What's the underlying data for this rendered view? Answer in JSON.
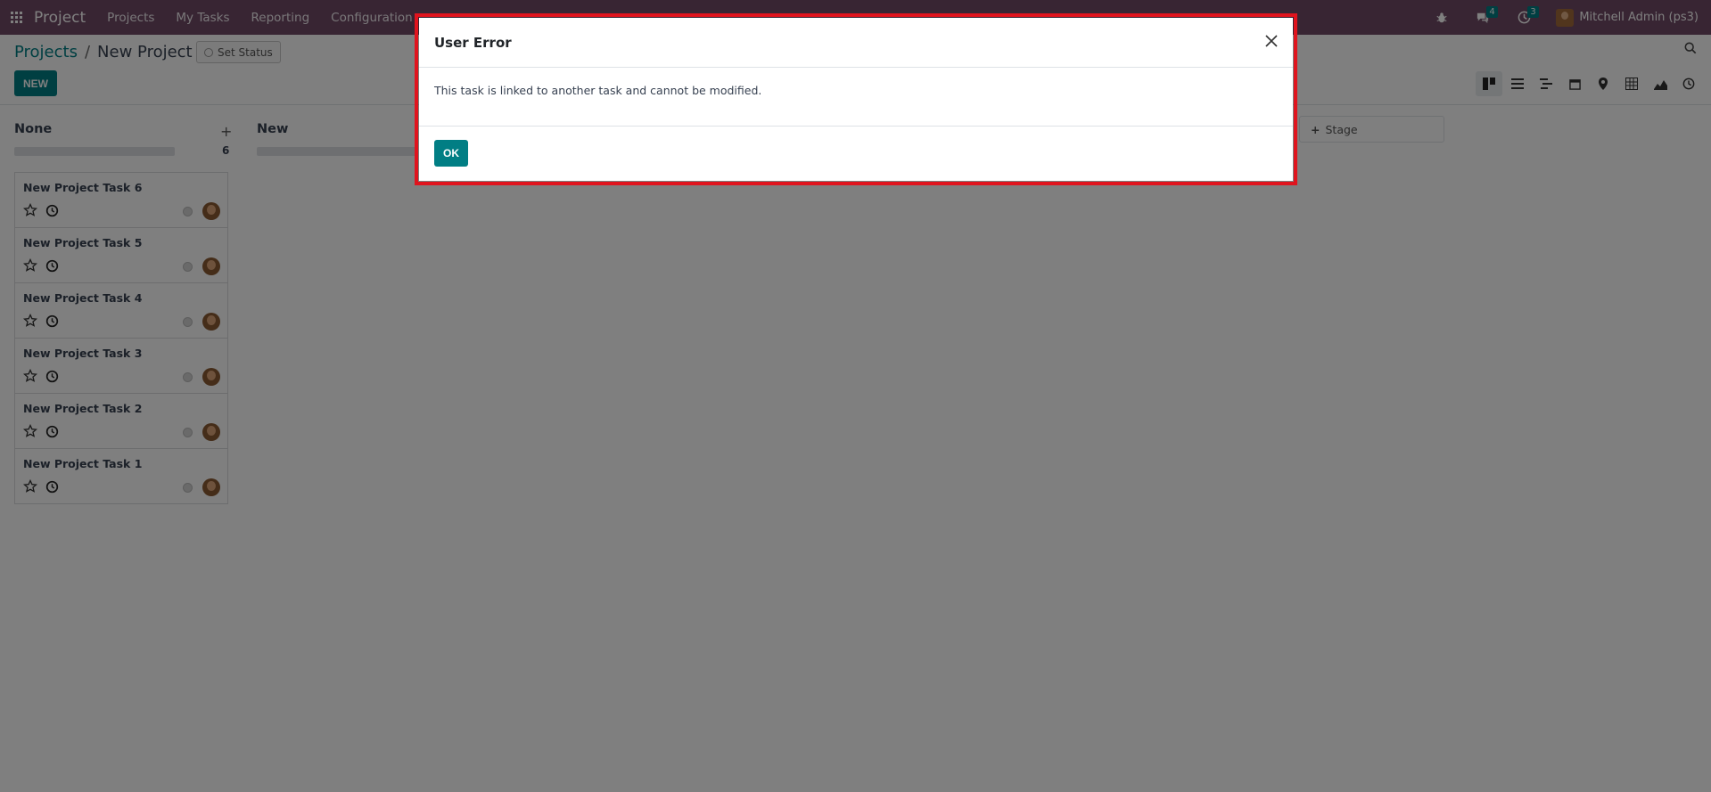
{
  "navbar": {
    "brand": "Project",
    "menu": [
      "Projects",
      "My Tasks",
      "Reporting",
      "Configuration"
    ],
    "messages_count": "4",
    "activities_count": "3",
    "user_name": "Mitchell Admin (ps3)"
  },
  "control_panel": {
    "breadcrumb_parent": "Projects",
    "breadcrumb_current": "New Project",
    "set_status_label": "Set Status",
    "new_button_label": "NEW"
  },
  "kanban": {
    "columns": [
      {
        "title": "None",
        "count": "6"
      },
      {
        "title": "New"
      }
    ],
    "add_stage_label": "Stage",
    "cards": [
      {
        "title": "New Project Task 6"
      },
      {
        "title": "New Project Task 5"
      },
      {
        "title": "New Project Task 4"
      },
      {
        "title": "New Project Task 3"
      },
      {
        "title": "New Project Task 2"
      },
      {
        "title": "New Project Task 1"
      }
    ]
  },
  "dialog": {
    "title": "User Error",
    "message": "This task is linked to another task and cannot be modified.",
    "ok_label": "OK"
  },
  "icons": {
    "apps": "apps-grid-icon",
    "bug": "bug-icon",
    "messages": "chat-icon",
    "activities": "clock-icon",
    "search": "search-icon",
    "close": "close-icon"
  },
  "colors": {
    "navbar": "#714b67",
    "primary": "#017e84",
    "dialog_highlight": "#e0141e"
  }
}
